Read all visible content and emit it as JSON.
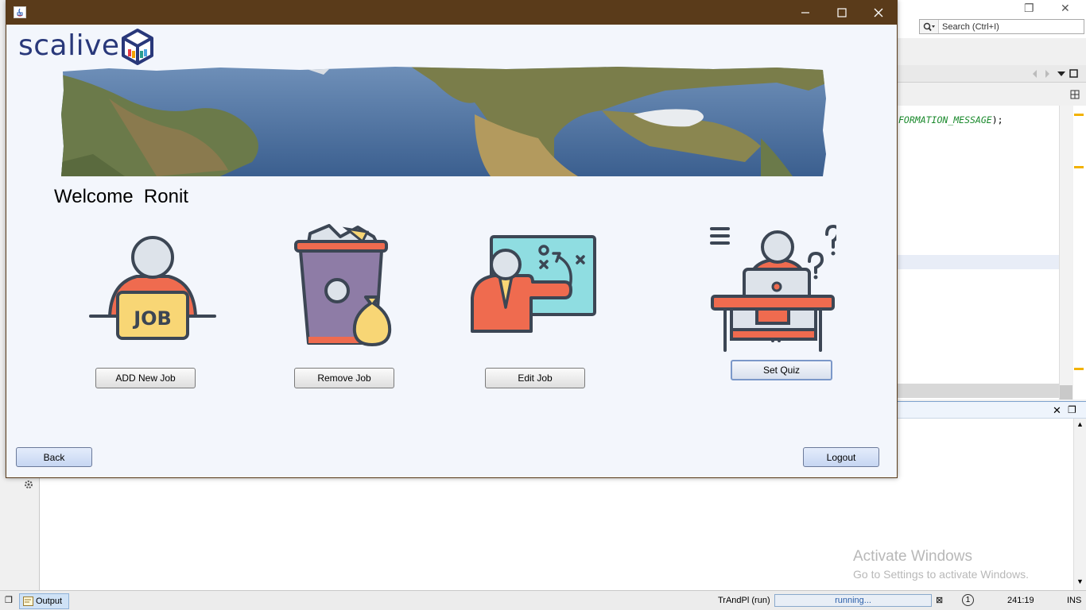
{
  "window": {
    "app_icon": "java-icon",
    "minimize_icon": "minimize-icon",
    "maximize_icon": "maximize-icon",
    "close_icon": "close-icon"
  },
  "logo": {
    "text": "scalive",
    "icon": "cube-logo-icon"
  },
  "banner": {
    "image": "world-map-banner"
  },
  "welcome": {
    "text": "Welcome  Ronit"
  },
  "actions": [
    {
      "label": "ADD New Job",
      "icon": "job-seeker-icon"
    },
    {
      "label": "Remove Job",
      "icon": "trash-bin-icon"
    },
    {
      "label": "Edit Job",
      "icon": "strategy-board-icon"
    },
    {
      "label": "Set Quiz",
      "icon": "quiz-desk-icon"
    }
  ],
  "back_label": "Back",
  "logout_label": "Logout",
  "ide": {
    "search_placeholder": "Search (Ctrl+I)",
    "code_keyword": "FORMATION_MESSAGE",
    "code_rest": ");",
    "output_tab": "Output",
    "run_label": "TrAndPl (run)",
    "progress_text": "running...",
    "notification_count": "1",
    "cursor_position": "241:19",
    "insert_mode": "INS",
    "watermark_title": "Activate Windows",
    "watermark_sub": "Go to Settings to activate Windows."
  },
  "colors": {
    "titlebar": "#5a3b1a",
    "window_bg": "#f3f6fc",
    "logo_blue": "#29387a",
    "icon_orange": "#ef6b4f",
    "icon_yellow": "#f8d675",
    "icon_purple": "#8e7ca6",
    "icon_teal": "#8fdde1",
    "icon_outline": "#3c4654"
  }
}
